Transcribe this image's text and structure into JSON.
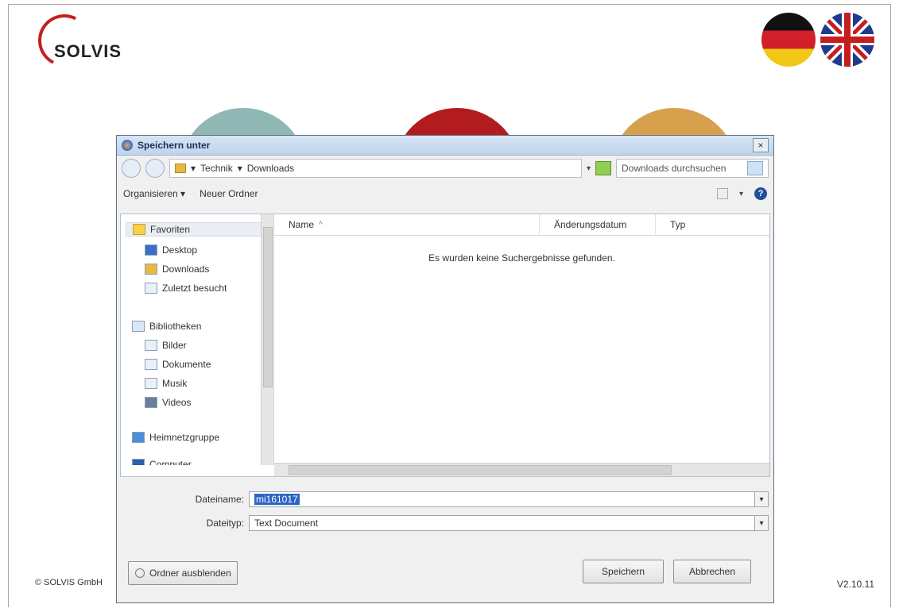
{
  "brand": {
    "name": "SOLVIS"
  },
  "footer": {
    "copyright": "© SOLVIS GmbH",
    "version": "V2.10.11"
  },
  "dialog": {
    "title": "Speichern unter",
    "close": "×",
    "breadcrumb": [
      "Technik",
      "Downloads"
    ],
    "search_placeholder": "Downloads durchsuchen",
    "toolbar": {
      "organize": "Organisieren",
      "new_folder": "Neuer Ordner"
    },
    "nav": {
      "favorites": "Favoriten",
      "desktop": "Desktop",
      "downloads": "Downloads",
      "recent": "Zuletzt besucht",
      "libraries": "Bibliotheken",
      "pictures": "Bilder",
      "documents": "Dokumente",
      "music": "Musik",
      "videos": "Videos",
      "homegroup": "Heimnetzgruppe",
      "computer": "Computer"
    },
    "columns": {
      "name": "Name",
      "modified": "Änderungsdatum",
      "type": "Typ"
    },
    "empty_message": "Es wurden keine Suchergebnisse gefunden.",
    "filename_label": "Dateiname:",
    "filename_value": "mi161017",
    "filetype_label": "Dateityp:",
    "filetype_value": "Text Document",
    "hide_folders": "Ordner ausblenden",
    "save": "Speichern",
    "cancel": "Abbrechen"
  }
}
